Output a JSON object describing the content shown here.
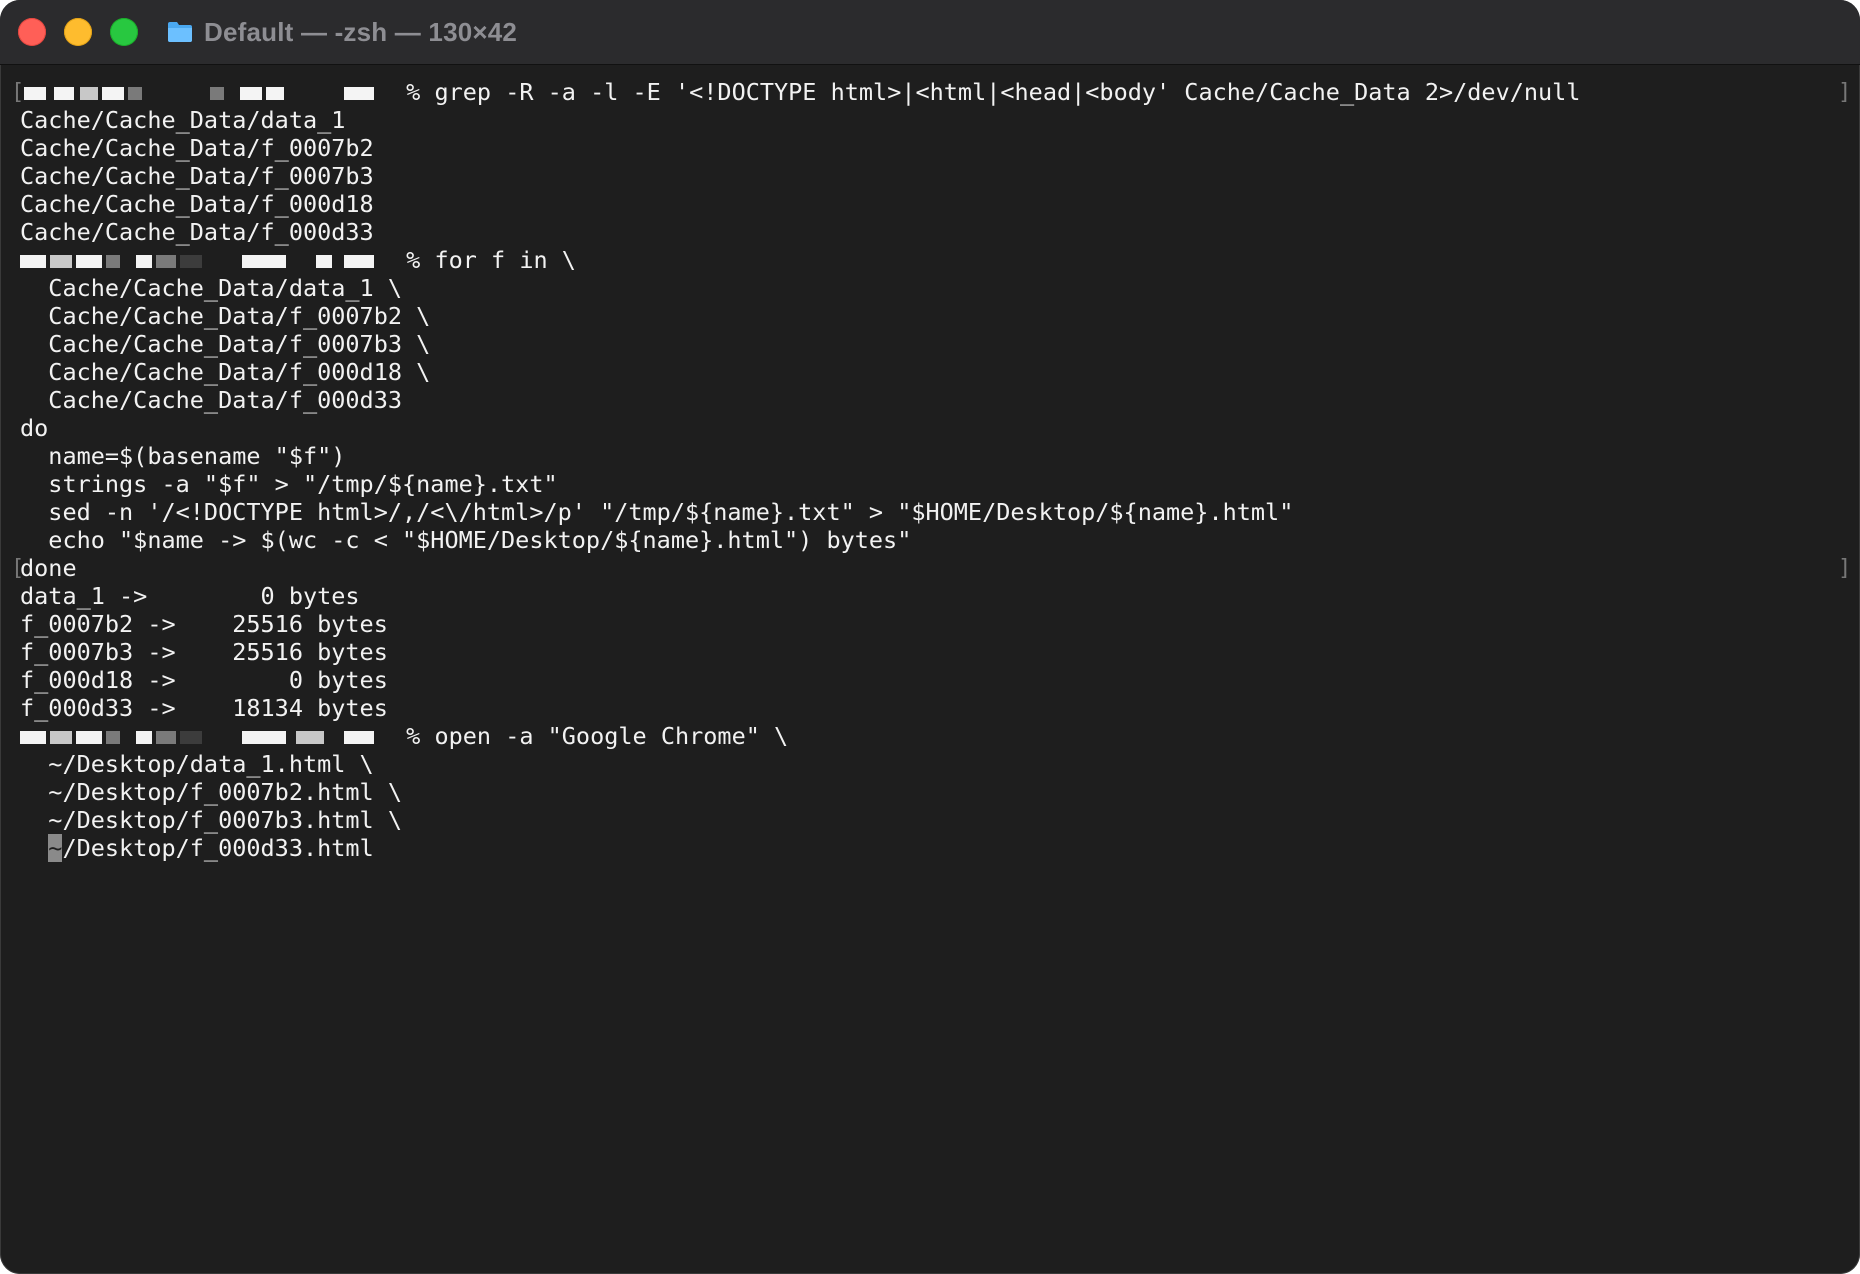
{
  "window": {
    "title": "Default — -zsh — 130×42",
    "folder_icon": "folder-icon",
    "colors": {
      "background": "#1e1e1e",
      "titlebar": "#2b2b2d",
      "text": "#f2f2f2",
      "close": "#ff5f57",
      "minimize": "#febc2e",
      "zoom": "#28c840"
    }
  },
  "terminal": {
    "prompt_suffix": " % ",
    "cmd1": {
      "command": "grep -R -a -l -E '<!DOCTYPE html>|<html|<head|<body' Cache/Cache_Data 2>/dev/null",
      "output": [
        "Cache/Cache_Data/data_1",
        "Cache/Cache_Data/f_0007b2",
        "Cache/Cache_Data/f_0007b3",
        "Cache/Cache_Data/f_000d18",
        "Cache/Cache_Data/f_000d33"
      ]
    },
    "cmd2": {
      "command": "for f in \\",
      "continuation": [
        "  Cache/Cache_Data/data_1 \\",
        "  Cache/Cache_Data/f_0007b2 \\",
        "  Cache/Cache_Data/f_0007b3 \\",
        "  Cache/Cache_Data/f_000d18 \\",
        "  Cache/Cache_Data/f_000d33",
        "do",
        "  name=$(basename \"$f\")",
        "  strings -a \"$f\" > \"/tmp/${name}.txt\"",
        "  sed -n '/<!DOCTYPE html>/,/<\\/html>/p' \"/tmp/${name}.txt\" > \"$HOME/Desktop/${name}.html\"",
        "  echo \"$name -> $(wc -c < \"$HOME/Desktop/${name}.html\") bytes\"",
        "done"
      ],
      "output": [
        "data_1 ->        0 bytes",
        "f_0007b2 ->    25516 bytes",
        "f_0007b3 ->    25516 bytes",
        "f_000d18 ->        0 bytes",
        "f_000d33 ->    18134 bytes"
      ]
    },
    "cmd3": {
      "command": "open -a \"Google Chrome\" \\",
      "continuation": [
        "  ~/Desktop/data_1.html \\",
        "  ~/Desktop/f_0007b2.html \\",
        "  ~/Desktop/f_0007b3.html \\"
      ],
      "last_line_cursor_char": "~",
      "last_line_rest": "/Desktop/f_000d33.html"
    }
  }
}
